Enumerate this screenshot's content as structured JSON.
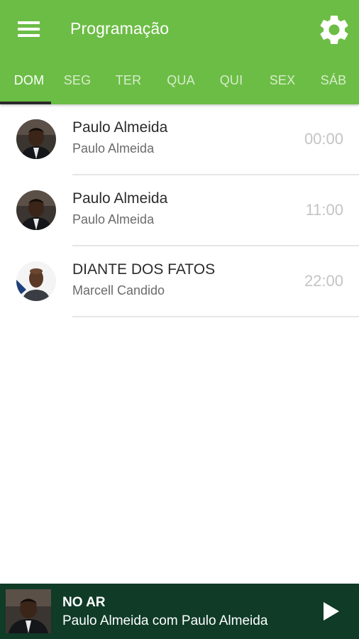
{
  "header": {
    "title": "Programação",
    "menu_icon": "menu-icon",
    "settings_icon": "gear-icon",
    "color": "#6cbd45"
  },
  "tabs": [
    {
      "label": "DOM",
      "active": true
    },
    {
      "label": "SEG",
      "active": false
    },
    {
      "label": "TER",
      "active": false
    },
    {
      "label": "QUA",
      "active": false
    },
    {
      "label": "QUI",
      "active": false
    },
    {
      "label": "SEX",
      "active": false
    },
    {
      "label": "SÁB",
      "active": false
    }
  ],
  "programs": [
    {
      "title": "Paulo Almeida",
      "host": "Paulo Almeida",
      "time": "00:00",
      "avatar": "host-photo-paulo"
    },
    {
      "title": "Paulo Almeida",
      "host": "Paulo Almeida",
      "time": "11:00",
      "avatar": "host-photo-paulo"
    },
    {
      "title": "DIANTE DOS FATOS",
      "host": "Marcell Candido",
      "time": "22:00",
      "avatar": "host-photo-marcell"
    }
  ],
  "player": {
    "label": "NO AR",
    "now_playing": "Paulo Almeida com Paulo Almeida",
    "play_icon": "play-icon",
    "background": "#0f3b27"
  }
}
